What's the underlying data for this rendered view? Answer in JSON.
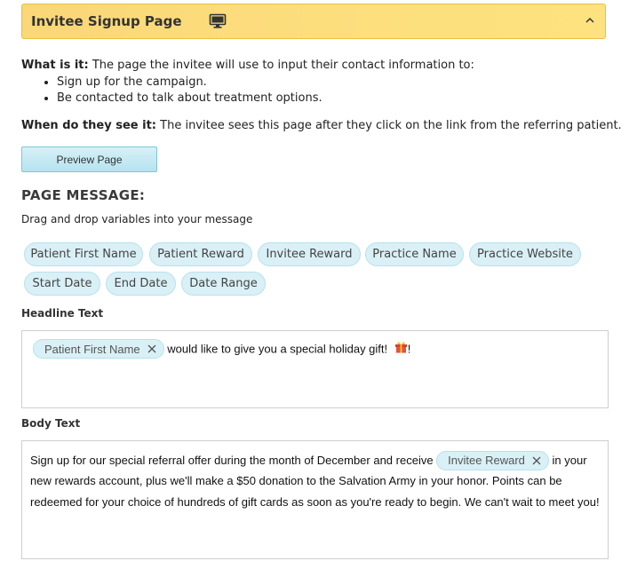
{
  "header": {
    "title": "Invitee Signup Page"
  },
  "what_is_it": {
    "label": "What is it:",
    "text": " The page the invitee will use to input their contact information to:",
    "bullets": [
      "Sign up for the campaign.",
      "Be contacted to talk about treatment options."
    ]
  },
  "when_see": {
    "label": "When do they see it:",
    "text": " The invitee sees this page after they click on the link from the referring patient."
  },
  "preview_button": "Preview Page",
  "page_message": {
    "title": "PAGE MESSAGE:",
    "subtitle": "Drag and drop variables into your message",
    "variables": [
      "Patient First Name",
      "Patient Reward",
      "Invitee Reward",
      "Practice Name",
      "Practice Website",
      "Start Date",
      "End Date",
      "Date Range"
    ]
  },
  "headline": {
    "label": "Headline Text",
    "token": "Patient First Name",
    "text": " would like to give you a special holiday gift! ",
    "trailing": "!"
  },
  "body": {
    "label": "Body Text",
    "text_before": "Sign up for our special referral offer during the month of December and receive ",
    "token": "Invitee Reward",
    "line1_after": " in your",
    "line2": "new rewards account, plus we'll make a $50 donation to the Salvation Army in your honor. Points can be",
    "line3": "redeemed for your choice of hundreds of gift cards as soon as you're ready to begin. We can't wait to meet you!"
  },
  "colors": {
    "header_bg": "#fddf7e",
    "chip_bg": "#d9f0f6",
    "button_bg": "#b6e3ef"
  },
  "icons": [
    "monitor-icon",
    "chevron-up-icon",
    "remove-x-icon",
    "gift-icon"
  ]
}
